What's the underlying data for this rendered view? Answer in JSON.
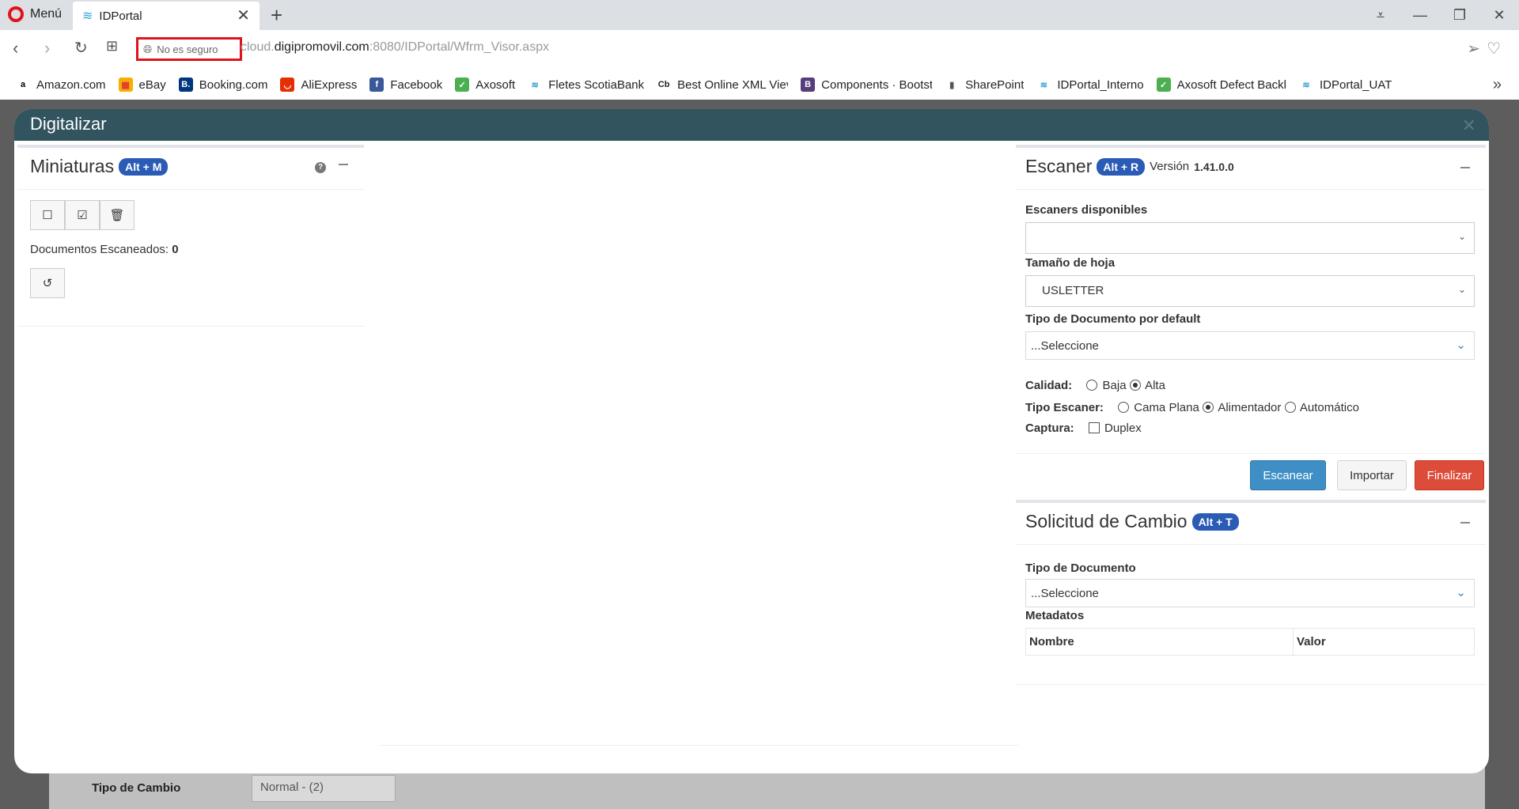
{
  "browser": {
    "menu_label": "Menú",
    "tab_title": "IDPortal",
    "security_label": "No es seguro",
    "url_prefix": "cloud.",
    "url_host": "digipromovil.com",
    "url_path": ":8080/IDPortal/Wfrm_Visor.aspx",
    "bookmarks": [
      {
        "label": "Amazon.com",
        "icon": "amazon-icon"
      },
      {
        "label": "eBay",
        "icon": "ebay-icon"
      },
      {
        "label": "Booking.com",
        "icon": "booking-icon"
      },
      {
        "label": "AliExpress",
        "icon": "aliexpress-icon"
      },
      {
        "label": "Facebook",
        "icon": "facebook-icon"
      },
      {
        "label": "Axosoft",
        "icon": "axosoft-icon"
      },
      {
        "label": "Fletes ScotiaBank",
        "icon": "idportal-icon"
      },
      {
        "label": "Best Online XML Viev",
        "icon": "cb-icon"
      },
      {
        "label": "Components · Bootst",
        "icon": "bootstrap-icon"
      },
      {
        "label": "SharePoint",
        "icon": "page-icon"
      },
      {
        "label": "IDPortal_Interno",
        "icon": "idportal-icon"
      },
      {
        "label": "Axosoft  Defect Backl",
        "icon": "axosoft-icon"
      },
      {
        "label": "IDPortal_UAT",
        "icon": "idportal-icon"
      }
    ]
  },
  "page_under": {
    "tipo_cambio_label": "Tipo de Cambio",
    "tipo_cambio_value": "Normal - (2)"
  },
  "modal": {
    "title": "Digitalizar",
    "miniaturas": {
      "title": "Miniaturas",
      "shortcut": "Alt + M",
      "docs_label": "Documentos Escaneados:",
      "docs_count": "0"
    },
    "escaner": {
      "title": "Escaner",
      "shortcut": "Alt + R",
      "version_label": "Versión",
      "version": "1.41.0.0",
      "available_label": "Escaners disponibles",
      "available_value": "",
      "paper_label": "Tamaño de hoja",
      "paper_value": "USLETTER",
      "doc_type_label": "Tipo de Documento por default",
      "doc_type_value": "...Seleccione",
      "quality_label": "Calidad:",
      "quality_low": "Baja",
      "quality_high": "Alta",
      "quality_selected": "Alta",
      "scanner_type_label": "Tipo Escaner:",
      "scanner_flat": "Cama Plana",
      "scanner_feeder": "Alimentador",
      "scanner_auto": "Automático",
      "scanner_type_selected": "Alimentador",
      "capture_label": "Captura:",
      "capture_duplex": "Duplex",
      "duplex_checked": false
    },
    "actions": {
      "scan": "Escanear",
      "import": "Importar",
      "finish": "Finalizar"
    },
    "solicitud": {
      "title": "Solicitud de Cambio",
      "shortcut": "Alt + T",
      "doc_type_label": "Tipo de Documento",
      "doc_type_value": "...Seleccione",
      "metadata_label": "Metadatos",
      "col_name": "Nombre",
      "col_value": "Valor"
    }
  }
}
